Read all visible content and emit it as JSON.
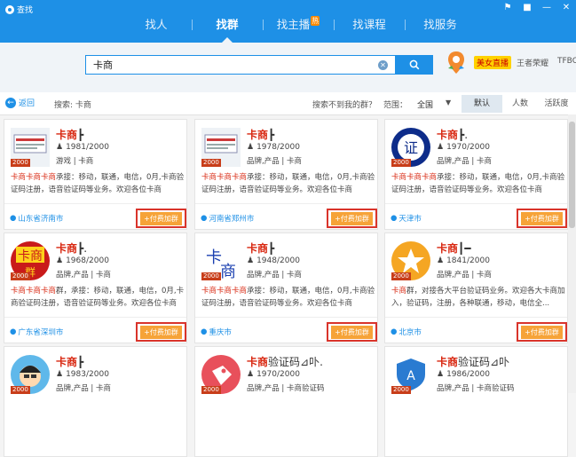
{
  "window": {
    "title": "查找",
    "controls": [
      "pin",
      "skin",
      "minimize",
      "close"
    ]
  },
  "nav": {
    "tabs": [
      {
        "label": "找人",
        "active": false
      },
      {
        "label": "找群",
        "active": true
      },
      {
        "label": "找主播",
        "active": false,
        "badge": "热"
      },
      {
        "label": "找课程",
        "active": false
      },
      {
        "label": "找服务",
        "active": false
      }
    ]
  },
  "search": {
    "value": "卡商",
    "placeholder": ""
  },
  "promo": {
    "badge": "美女直播",
    "link1": "王者荣耀",
    "link2": "TFBO"
  },
  "filter": {
    "back_label": "返回",
    "search_text": "搜索: 卡商",
    "not_found": "搜索不到我的群？",
    "range_label": "范围：",
    "region": "全国",
    "sort_tabs": [
      {
        "label": "默认",
        "active": true
      },
      {
        "label": "人数",
        "active": false
      },
      {
        "label": "活跃度",
        "active": false
      }
    ]
  },
  "join_label": "+付费加群",
  "level_label": "2000",
  "colors": {
    "accent": "#1e90e6",
    "highlight": "#d8260f",
    "join": "#f6a338",
    "box": "#d9342b"
  },
  "cards": [
    {
      "name": "卡商",
      "suffix": "┣",
      "members": "1981/2000",
      "tags": "游戏 | 卡商",
      "desc_hl": "卡商卡商卡商",
      "desc": "承接：移动，联通，电信，0月,卡商验证码注册，语音验证码等业务。欢迎各位卡商",
      "location": "山东省济南市",
      "avatar": "doc"
    },
    {
      "name": "卡商",
      "suffix": "┣",
      "members": "1978/2000",
      "tags": "品牌,产品 | 卡商",
      "desc_hl": "卡商卡商卡商",
      "desc": "承接：移动，联通，电信，0月,卡商验证码注册，语音验证码等业务。欢迎各位卡商",
      "location": "河南省郑州市",
      "avatar": "doc"
    },
    {
      "name": "卡商",
      "suffix": "┣.",
      "members": "1970/2000",
      "tags": "品牌,产品 | 卡商",
      "desc_hl": "卡商卡商卡商",
      "desc": "承接：移动，联通，电信，0月,卡商验证码注册，语音验证码等业务。欢迎各位卡商",
      "location": "天津市",
      "avatar": "zheng"
    },
    {
      "name": "卡商",
      "suffix": "┣.",
      "members": "1968/2000",
      "tags": "品牌,产品 | 卡商",
      "desc_hl": "卡商卡商卡商",
      "desc": "群，承接：移动，联通，电信，0月,卡商验证码注册，语音验证码等业务。欢迎各位卡商",
      "location": "广东省深圳市",
      "avatar": "kashang"
    },
    {
      "name": "卡商",
      "suffix": "┣",
      "members": "1948/2000",
      "tags": "品牌,产品 | 卡商",
      "desc_hl": "卡商卡商卡商",
      "desc": "承接：移动，联通，电信，0月,卡商验证码注册，语音验证码等业务。欢迎各位卡商",
      "location": "重庆市",
      "avatar": "ka"
    },
    {
      "name": "卡商",
      "suffix": "┃━",
      "members": "1841/2000",
      "tags": "品牌,产品 | 卡商",
      "desc_hl": "卡商",
      "desc": "群，对接各大平台验证码业务。欢迎各大卡商加入，验证码，注册，各种联通，移动，电信全...",
      "location": "北京市",
      "avatar": "star"
    },
    {
      "name": "卡商",
      "suffix": "┣",
      "members": "1983/2000",
      "tags": "品牌,产品 | 卡商",
      "desc_hl": "",
      "desc": "",
      "location": "",
      "avatar": "boy"
    },
    {
      "name": "卡商",
      "suffix": "验证码⊿卟.",
      "members": "1970/2000",
      "tags": "品牌,产品 | 卡商验证码",
      "desc_hl": "",
      "desc": "",
      "location": "",
      "avatar": "tag"
    },
    {
      "name": "卡商",
      "suffix": "验证码⊿卟",
      "members": "1986/2000",
      "tags": "品牌,产品 | 卡商验证码",
      "desc_hl": "",
      "desc": "",
      "location": "",
      "avatar": "shield"
    }
  ]
}
